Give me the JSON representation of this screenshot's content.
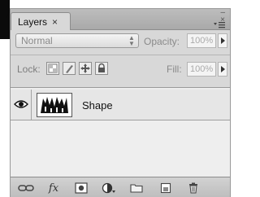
{
  "panel": {
    "tab_label": "Layers",
    "tab_close": "×",
    "window_controls": {
      "collapse": "–",
      "close": "×"
    }
  },
  "blend": {
    "mode": "Normal",
    "opacity_label": "Opacity:",
    "opacity_value": "100%"
  },
  "lock": {
    "label": "Lock:",
    "fill_label": "Fill:",
    "fill_value": "100%"
  },
  "layers": [
    {
      "name": "Shape",
      "visible": true
    }
  ],
  "footer": {
    "icons": [
      "link-layers-icon",
      "fx-icon",
      "add-mask-icon",
      "adjustment-layer-icon",
      "new-group-icon",
      "new-layer-icon",
      "delete-layer-icon"
    ],
    "fx_label": "fx"
  },
  "icons": {
    "lock_buttons": [
      "lock-transparent-pixels-icon",
      "lock-image-pixels-icon",
      "lock-position-icon",
      "lock-all-icon"
    ],
    "eye": "visibility-eye-icon",
    "panel_menu": "panel-menu-icon"
  }
}
